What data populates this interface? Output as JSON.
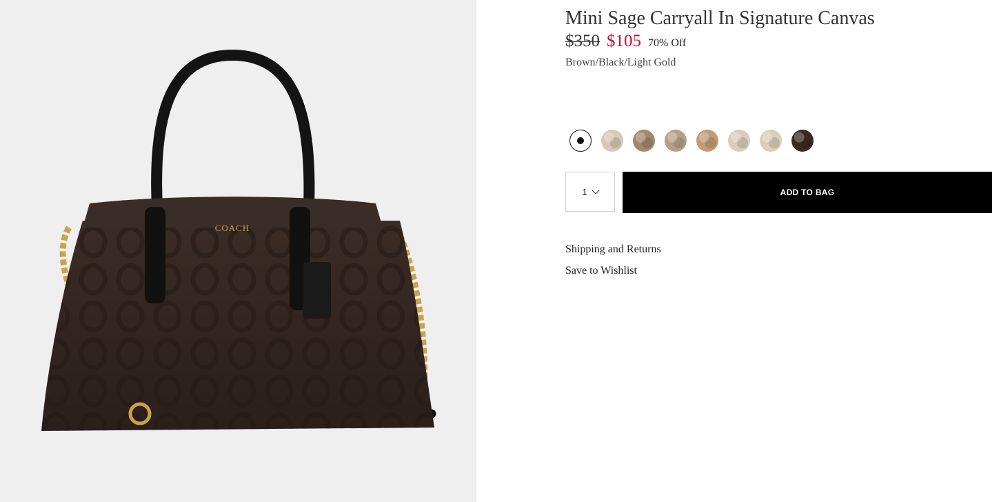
{
  "product": {
    "title": "Mini Sage Carryall In Signature Canvas",
    "original_price": "$350",
    "sale_price": "$105",
    "discount": "70% Off",
    "color_name": "Brown/Black/Light Gold",
    "image_alt": "Mini Sage Carryall handbag"
  },
  "swatches": [
    {
      "name": "Brown/Black/Light Gold",
      "color": "#ffffff",
      "selected": true
    },
    {
      "name": "Swatch 2",
      "color": "#d6c9b6",
      "selected": false
    },
    {
      "name": "Swatch 3",
      "color": "#a3876b",
      "selected": false
    },
    {
      "name": "Swatch 4",
      "color": "#b5a085",
      "selected": false
    },
    {
      "name": "Swatch 5",
      "color": "#c29a74",
      "selected": false
    },
    {
      "name": "Swatch 6",
      "color": "#d9ccbb",
      "selected": false
    },
    {
      "name": "Swatch 7",
      "color": "#dccdb6",
      "selected": false
    },
    {
      "name": "Swatch 8",
      "color": "#3a2a22",
      "selected": false
    }
  ],
  "purchase": {
    "quantity": "1",
    "add_to_bag_label": "ADD TO BAG"
  },
  "links": {
    "shipping": "Shipping and Returns",
    "wishlist": "Save to Wishlist"
  },
  "colors": {
    "sale_red": "#c8102e",
    "button_black": "#000000",
    "image_bg": "#efefef"
  }
}
